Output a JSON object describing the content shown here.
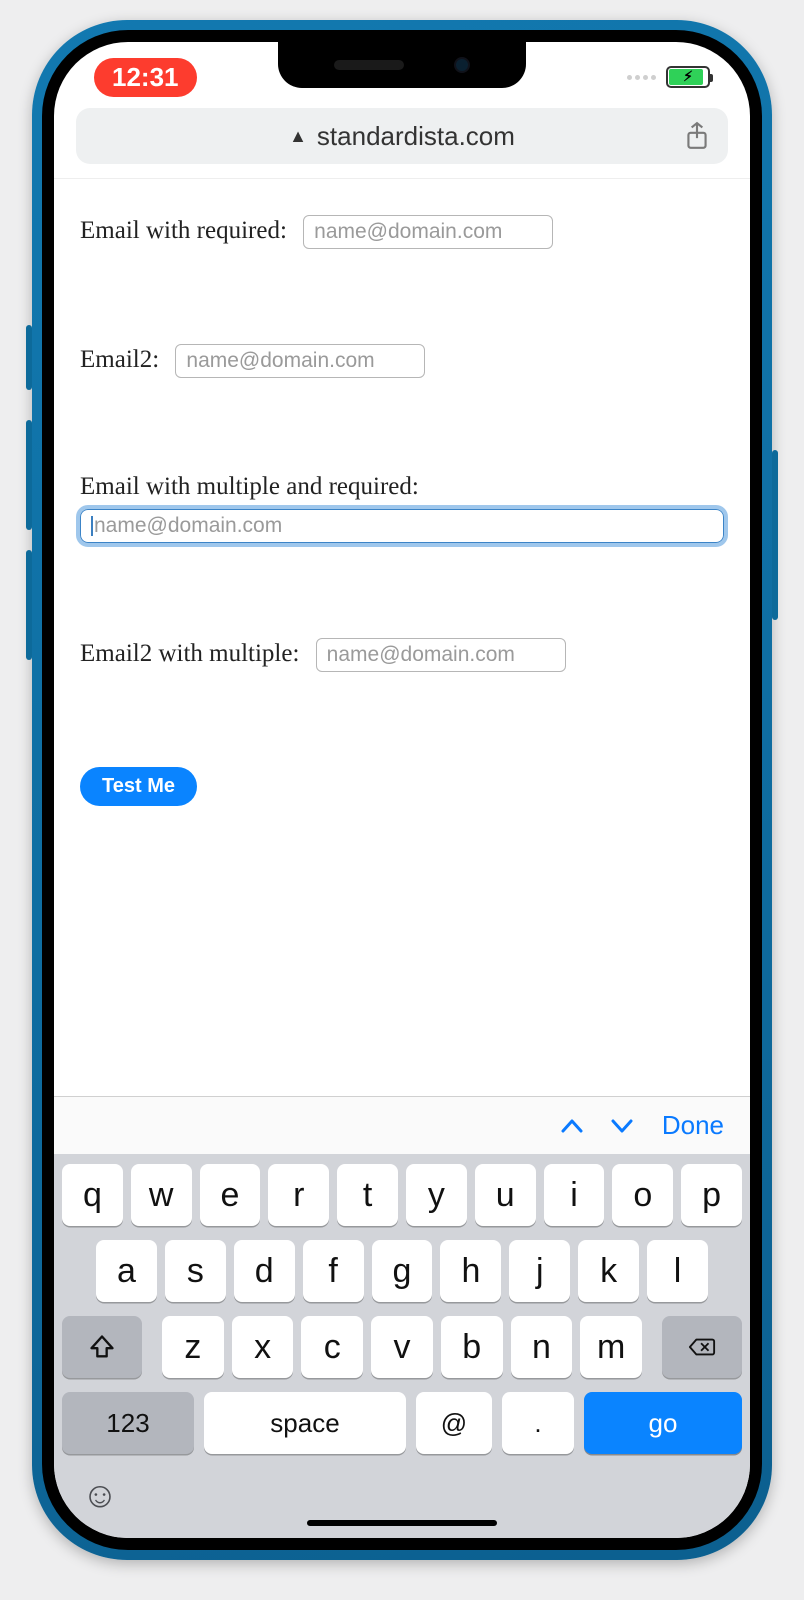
{
  "status": {
    "time": "12:31"
  },
  "urlbar": {
    "domain": "standardista.com"
  },
  "form": {
    "field1": {
      "label": "Email with required:",
      "placeholder": "name@domain.com"
    },
    "field2": {
      "label": "Email2:",
      "placeholder": "name@domain.com"
    },
    "field3": {
      "label": "Email with multiple and required:",
      "placeholder": "name@domain.com"
    },
    "field4": {
      "label": "Email2 with multiple:",
      "placeholder": "name@domain.com"
    },
    "submit_label": "Test Me"
  },
  "kb_accessory": {
    "done": "Done"
  },
  "keyboard": {
    "row1": [
      "q",
      "w",
      "e",
      "r",
      "t",
      "y",
      "u",
      "i",
      "o",
      "p"
    ],
    "row2": [
      "a",
      "s",
      "d",
      "f",
      "g",
      "h",
      "j",
      "k",
      "l"
    ],
    "row3": [
      "z",
      "x",
      "c",
      "v",
      "b",
      "n",
      "m"
    ],
    "numbers_label": "123",
    "space_label": "space",
    "at_label": "@",
    "dot_label": ".",
    "go_label": "go"
  }
}
